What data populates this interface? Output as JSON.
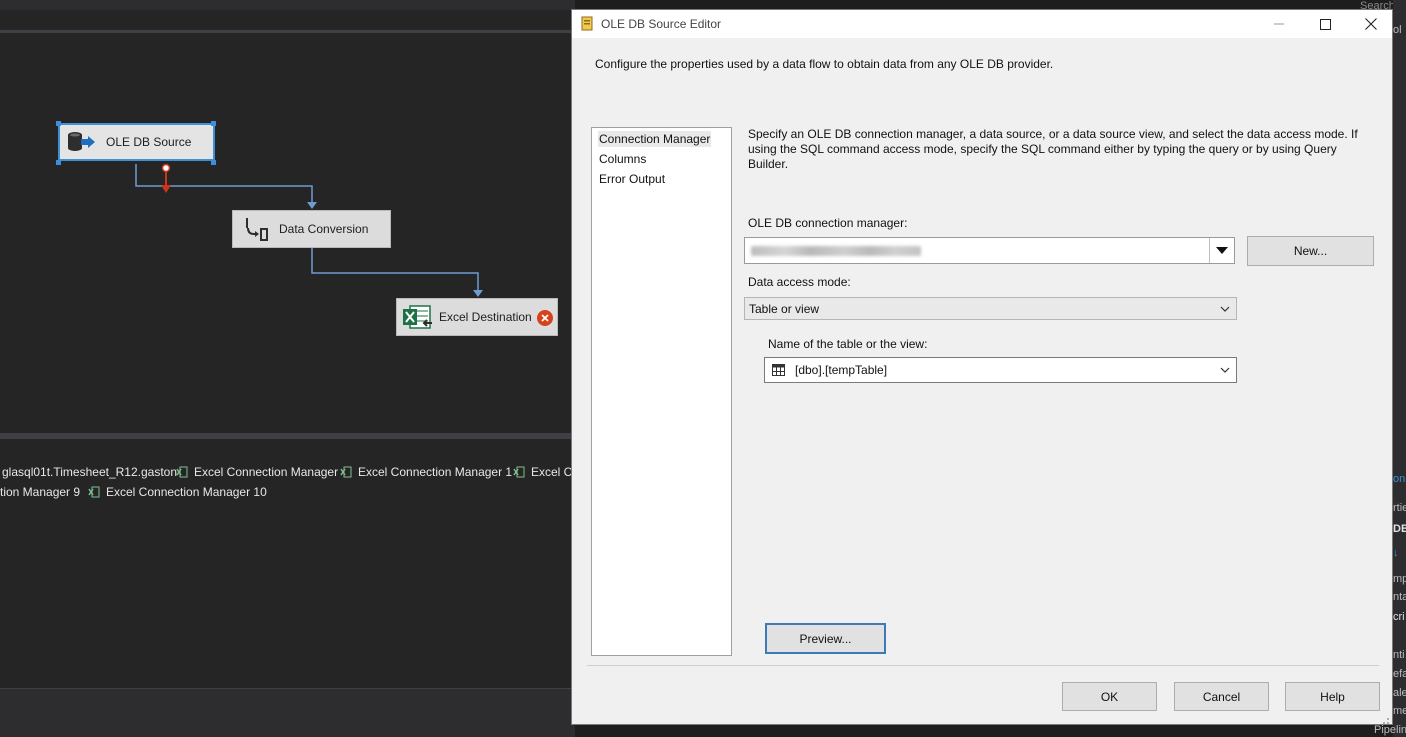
{
  "designer": {
    "components": {
      "ole_db_source": "OLE DB Source",
      "data_conversion": "Data Conversion",
      "excel_destination": "Excel Destination"
    },
    "connection_managers": {
      "row1": [
        "glasql01t.Timesheet_R12.gaston",
        "Excel Connection Manager",
        "Excel Connection Manager 1",
        "Excel Co"
      ],
      "row2": [
        "tion Manager 9",
        "Excel Connection Manager 10"
      ]
    }
  },
  "right_strip": {
    "search": "Search S",
    "fragments": [
      "ol",
      "on",
      "rtie",
      "DB",
      "↓",
      "mp",
      "nta",
      "cri",
      "nti",
      "efa",
      "ale",
      "me",
      "Pipelin"
    ]
  },
  "dialog": {
    "title": "OLE DB Source Editor",
    "description": "Configure the properties used by a data flow to obtain data from any OLE DB provider.",
    "nav": [
      "Connection Manager",
      "Columns",
      "Error Output"
    ],
    "main_description": "Specify an OLE DB connection manager, a data source, or a data source view, and select the data access mode. If using the SQL command access mode, specify the SQL command either by typing the query or by using Query Builder.",
    "connection_manager_label": "OLE DB connection manager:",
    "new_button": "New...",
    "access_mode_label": "Data access mode:",
    "access_mode_value": "Table or view",
    "table_label": "Name of the table or the view:",
    "table_value": "[dbo].[tempTable]",
    "preview_button": "Preview...",
    "ok_button": "OK",
    "cancel_button": "Cancel",
    "help_button": "Help"
  },
  "colors": {
    "selection_blue": "#3c8fd8",
    "path_arrow": "#6f9bd1",
    "error_path": "#c8371a",
    "error_badge": "#d5421b"
  }
}
